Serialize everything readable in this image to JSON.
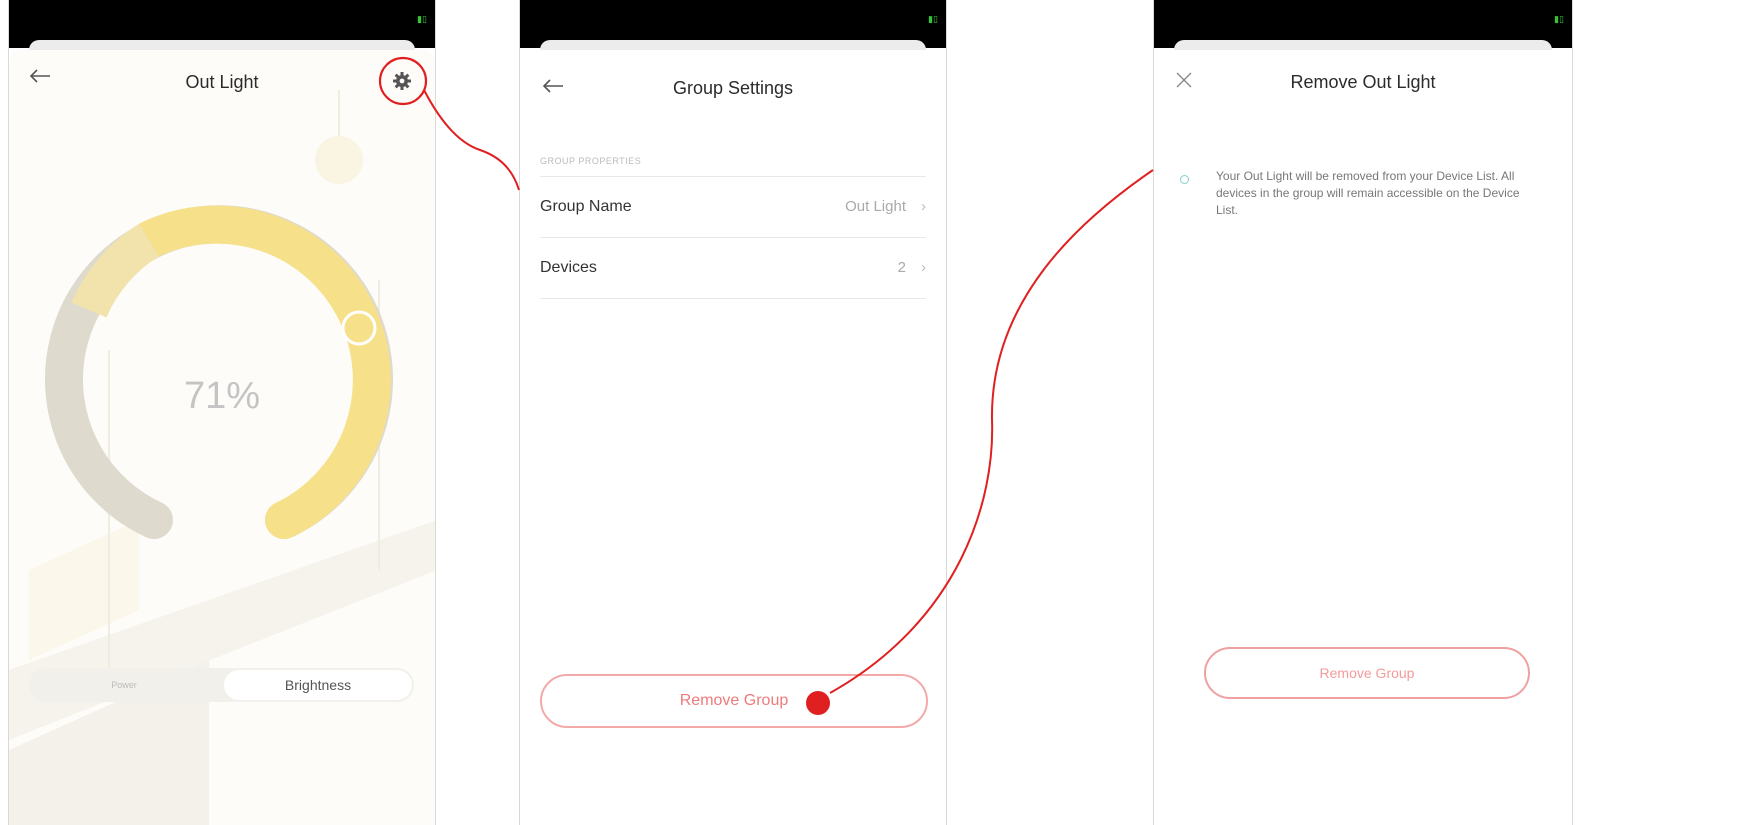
{
  "screen1": {
    "title": "Out Light",
    "brightness_text": "71%",
    "brightness_level": 0.71,
    "tabs": [
      "Power",
      "Brightness"
    ],
    "icons": {
      "back": "back-arrow-icon",
      "settings": "gear-icon"
    }
  },
  "screen2": {
    "title": "Group Settings",
    "section_header": "GROUP PROPERTIES",
    "rows": [
      {
        "label": "Group Name",
        "value": "Out Light"
      },
      {
        "label": "Devices",
        "value": "2"
      }
    ],
    "remove_label": "Remove Group",
    "icons": {
      "back": "back-arrow-icon",
      "chevron": "chevron-right-icon"
    }
  },
  "screen3": {
    "title": "Remove Out Light",
    "info_text": "Your Out Light will be removed from your Device List. All devices in the group will remain accessible on the Device List.",
    "remove_label": "Remove Group",
    "icons": {
      "close": "close-icon",
      "info": "info-dot-icon"
    }
  },
  "colors": {
    "accent_red": "#e02020",
    "ring_yellow": "#f7e08a",
    "ring_gray": "#d9d4c2",
    "button_red": "#ef7a7a"
  }
}
